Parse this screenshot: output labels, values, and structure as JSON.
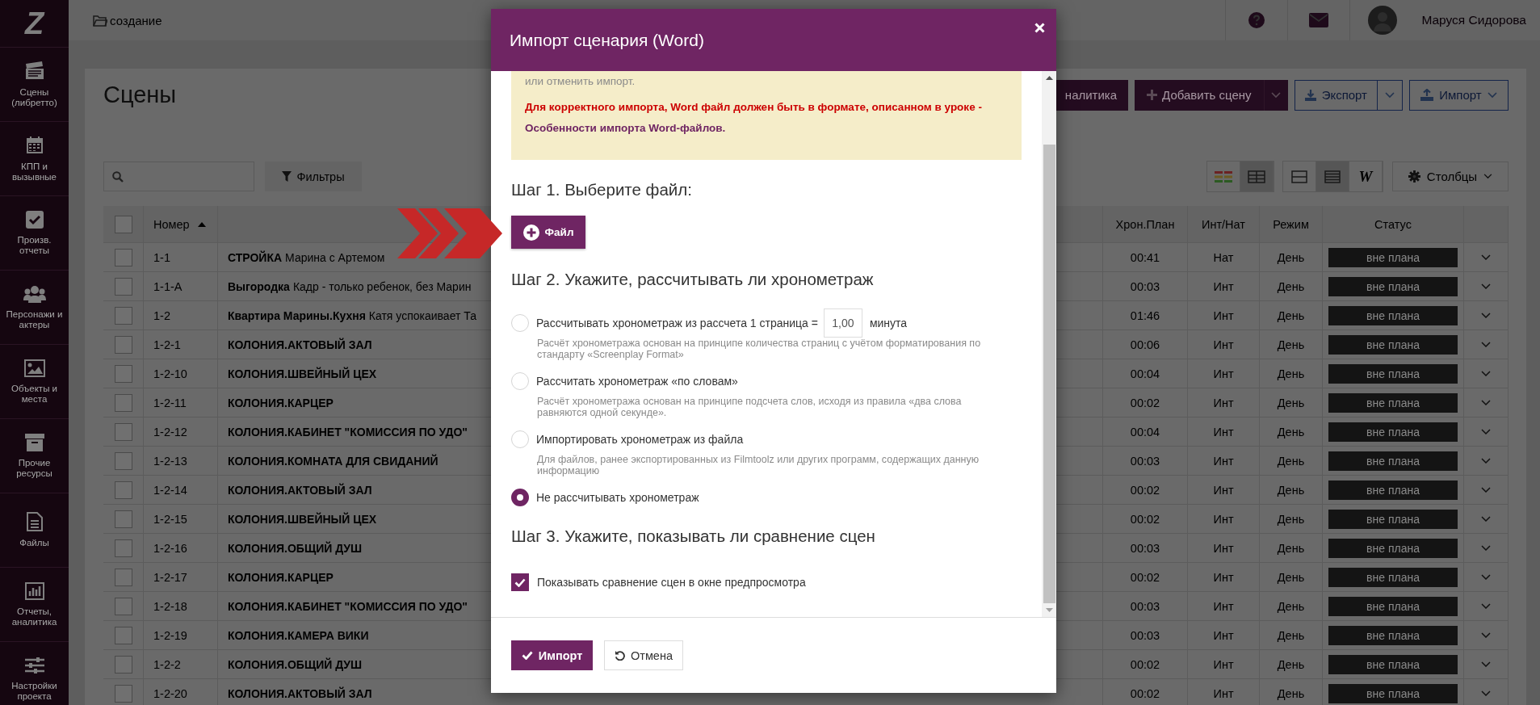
{
  "sidebar": {
    "logo": "Z",
    "items": [
      {
        "label": "Сцены (либретто)"
      },
      {
        "label": "КПП и вызывные"
      },
      {
        "label": "Произв. отчеты"
      },
      {
        "label": "Персонажи и актеры"
      },
      {
        "label": "Объекты и места"
      },
      {
        "label": "Прочие ресурсы"
      },
      {
        "label": "Файлы"
      },
      {
        "label": "Отчеты, аналитика"
      },
      {
        "label": "Настройки проекта"
      }
    ]
  },
  "topbar": {
    "breadcrumb": "создание",
    "user_name": "Маруся Сидорова"
  },
  "page": {
    "title": "Сцены",
    "actions": [
      {
        "label": "налитика",
        "kind": "plain"
      },
      {
        "label": "Добавить сцену",
        "kind": "add"
      },
      {
        "label": "Экспорт",
        "kind": "export"
      },
      {
        "label": "Импорт",
        "kind": "import"
      }
    ]
  },
  "toolbar": {
    "filters": "Фильтры",
    "view_toggles": [
      {
        "kind": "colors",
        "selected": false
      },
      {
        "kind": "grid",
        "selected": true
      },
      {
        "kind": "rows",
        "selected": false
      },
      {
        "kind": "list",
        "selected": true
      },
      {
        "kind": "text",
        "glyph": "W",
        "selected": false
      }
    ],
    "columns_button": "Столбцы"
  },
  "table": {
    "select_all_checked": false,
    "columns": [
      {
        "label": "Номер",
        "sort_ascending": true
      },
      {
        "label": "Хрон.План"
      },
      {
        "label": "Инт/Нат"
      },
      {
        "label": "Режим"
      },
      {
        "label": "Статус"
      }
    ],
    "rows": [
      {
        "number": "1-1",
        "title": "СТРОЙКА",
        "text": "Марина с Артемом",
        "time": "00:41",
        "int_nat": "Нат",
        "mode": "День",
        "status": "вне плана",
        "selected": false
      },
      {
        "number": "1-1-A",
        "title": "Выгородка",
        "text": "Кадр - только ребенок, без Марин",
        "time": "00:03",
        "int_nat": "Инт",
        "mode": "День",
        "status": "вне плана",
        "selected": false
      },
      {
        "number": "1-2",
        "title": "Квартира Марины.Кухня",
        "text": "Катя успокаивает Та",
        "time": "01:46",
        "int_nat": "Инт",
        "mode": "День",
        "status": "вне плана",
        "selected": false
      },
      {
        "number": "1-2-1",
        "title": "КОЛОНИЯ.АКТОВЫЙ ЗАЛ",
        "time": "00:06",
        "int_nat": "Инт",
        "mode": "День",
        "status": "вне плана",
        "selected": false
      },
      {
        "number": "1-2-10",
        "title": "КОЛОНИЯ.ШВЕЙНЫЙ ЦЕХ",
        "time": "00:04",
        "int_nat": "Инт",
        "mode": "День",
        "status": "вне плана",
        "selected": false
      },
      {
        "number": "1-2-11",
        "title": "КОЛОНИЯ.КАРЦЕР",
        "time": "00:02",
        "int_nat": "Инт",
        "mode": "День",
        "status": "вне плана",
        "selected": false
      },
      {
        "number": "1-2-12",
        "title": "КОЛОНИЯ.КАБИНЕТ \"КОМИССИЯ ПО УДО\"",
        "time": "00:04",
        "int_nat": "Инт",
        "mode": "День",
        "status": "вне плана",
        "selected": false
      },
      {
        "number": "1-2-13",
        "title": "КОЛОНИЯ.КОМНАТА ДЛЯ СВИДАНИЙ",
        "time": "00:03",
        "int_nat": "Инт",
        "mode": "День",
        "status": "вне плана",
        "selected": false
      },
      {
        "number": "1-2-14",
        "title": "КОЛОНИЯ.АКТОВЫЙ ЗАЛ",
        "time": "00:02",
        "int_nat": "Инт",
        "mode": "День",
        "status": "вне плана",
        "selected": false
      },
      {
        "number": "1-2-15",
        "title": "КОЛОНИЯ.ШВЕЙНЫЙ ЦЕХ",
        "time": "00:02",
        "int_nat": "Инт",
        "mode": "День",
        "status": "вне плана",
        "selected": false
      },
      {
        "number": "1-2-16",
        "title": "КОЛОНИЯ.ОБЩИЙ ДУШ",
        "time": "00:03",
        "int_nat": "Инт",
        "mode": "День",
        "status": "вне плана",
        "selected": false
      },
      {
        "number": "1-2-17",
        "title": "КОЛОНИЯ.КАРЦЕР",
        "time": "00:02",
        "int_nat": "Инт",
        "mode": "День",
        "status": "вне плана",
        "selected": false
      },
      {
        "number": "1-2-18",
        "title": "КОЛОНИЯ.КАБИНЕТ \"КОМИССИЯ ПО УДО\"",
        "time": "00:03",
        "int_nat": "Инт",
        "mode": "День",
        "status": "вне плана",
        "selected": false
      },
      {
        "number": "1-2-19",
        "title": "КОЛОНИЯ.КАМЕРА ВИКИ",
        "time": "00:03",
        "int_nat": "Инт",
        "mode": "День",
        "status": "вне плана",
        "selected": false
      },
      {
        "number": "1-2-2",
        "title": "КОЛОНИЯ.ОБЩИЙ ДУШ",
        "time": "00:02",
        "int_nat": "Инт",
        "mode": "День",
        "status": "вне плана",
        "selected": false
      },
      {
        "number": "1-2-20",
        "title": "КОЛОНИЯ.АКТОВЫЙ ЗАЛ",
        "time": "00:02",
        "int_nat": "Инт",
        "mode": "День",
        "status": "вне плана",
        "selected": false
      }
    ]
  },
  "modal": {
    "title": "Импорт сценария (Word)",
    "notice": {
      "text": "или отменить импорт.",
      "warning": "Для корректного импорта, Word файл должен быть в формате, описанном в уроке -",
      "link": "Особенности импорта Word-файлов."
    },
    "step1": {
      "heading": "Шаг 1. Выберите файл:",
      "button": "Файл"
    },
    "step2": {
      "heading": "Шаг 2. Укажите, рассчитывать ли хронометраж",
      "options": [
        {
          "kind": "pages",
          "label": "Рассчитывать хронометраж из рассчета 1 страница =",
          "value": "1,00",
          "unit": "минута",
          "hint": "Расчёт хронометража основан на принципе количества страниц с учётом форматирования по стандарту «Screenplay Format»",
          "selected": false
        },
        {
          "kind": "plain",
          "label": "Рассчитать хронометраж «по словам»",
          "hint": "Расчёт хронометража основан на принципе подсчета слов, исходя из правила «два слова равняются одной секунде».",
          "selected": false
        },
        {
          "kind": "plain",
          "label": "Импортировать хронометраж из файла",
          "hint": "Для файлов, ранее экспортированных из Filmtoolz или других программ, содержащих данную информацию",
          "selected": false
        },
        {
          "kind": "plain",
          "label": "Не рассчитывать хронометраж",
          "selected": true
        }
      ]
    },
    "step3": {
      "heading": "Шаг 3. Укажите, показывать ли сравнение сцен",
      "checkbox": {
        "label": "Показывать сравнение сцен в окне предпросмотра",
        "checked": true
      }
    },
    "buttons": [
      {
        "label": "Импорт",
        "kind": "primary"
      },
      {
        "label": "Отмена",
        "kind": "secondary"
      }
    ]
  }
}
